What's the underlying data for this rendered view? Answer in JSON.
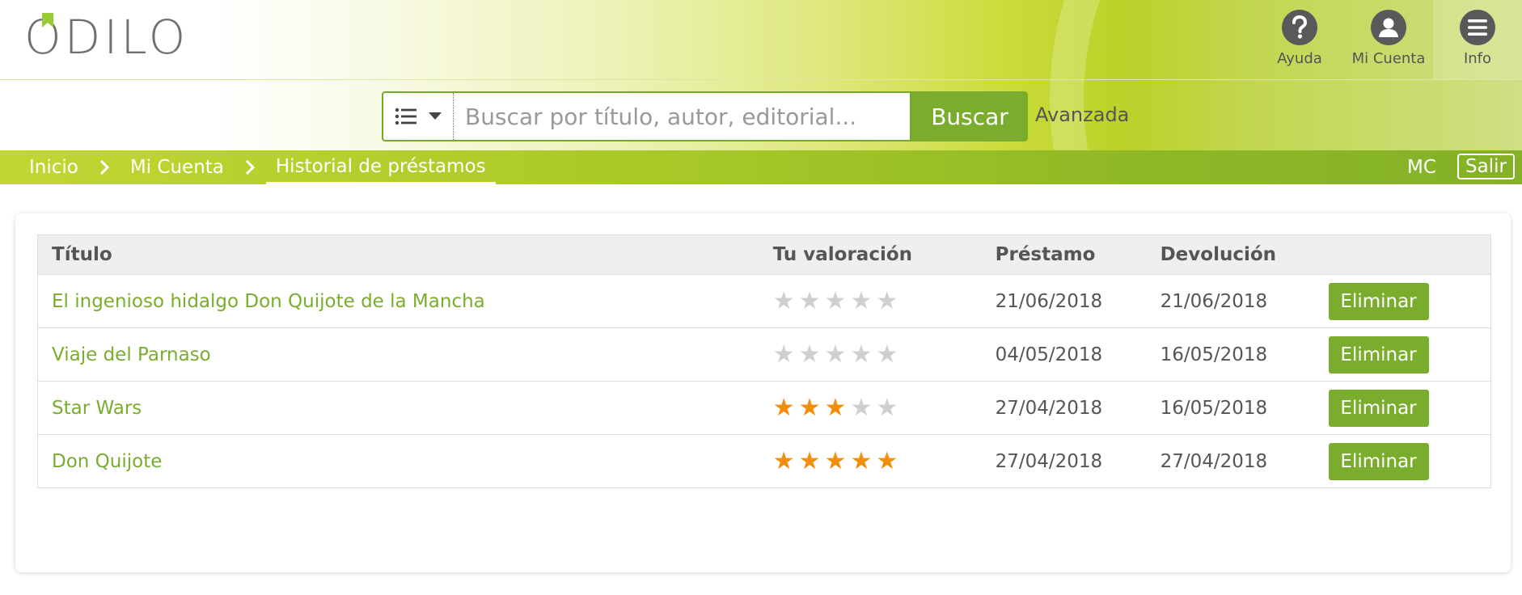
{
  "brand": {
    "logo_text": "ODILO"
  },
  "top_nav": {
    "help_label": "Ayuda",
    "account_label": "Mi Cuenta",
    "info_label": "Info"
  },
  "search": {
    "placeholder": "Buscar por título, autor, editorial...",
    "value": "",
    "button_label": "Buscar",
    "advanced_label": "Avanzada"
  },
  "breadcrumb": {
    "items": [
      "Inicio",
      "Mi Cuenta",
      "Historial de préstamos"
    ]
  },
  "user": {
    "initials": "MC",
    "logout_label": "Salir"
  },
  "table": {
    "columns": [
      "Título",
      "Tu valoración",
      "Préstamo",
      "Devolución",
      ""
    ],
    "rows": [
      {
        "title": "El ingenioso hidalgo Don Quijote de la Mancha",
        "rating": 0,
        "max_rating": 5,
        "loan": "21/06/2018",
        "return": "21/06/2018",
        "action": "Eliminar"
      },
      {
        "title": "Viaje del Parnaso",
        "rating": 0,
        "max_rating": 5,
        "loan": "04/05/2018",
        "return": "16/05/2018",
        "action": "Eliminar"
      },
      {
        "title": "Star Wars",
        "rating": 3,
        "max_rating": 5,
        "loan": "27/04/2018",
        "return": "16/05/2018",
        "action": "Eliminar"
      },
      {
        "title": "Don Quijote",
        "rating": 5,
        "max_rating": 5,
        "loan": "27/04/2018",
        "return": "27/04/2018",
        "action": "Eliminar"
      }
    ]
  },
  "icons": {
    "help": "question-circle-icon",
    "account": "user-circle-icon",
    "info": "menu-circle-icon",
    "search_type": "list-icon",
    "breadcrumb_separator": "chevron-right-icon",
    "star": "star-icon"
  },
  "colors": {
    "accent": "#7aad2d",
    "star_on": "#f0900a",
    "star_off": "#cfcfcf",
    "brand_bookmark": "#9acb34"
  }
}
